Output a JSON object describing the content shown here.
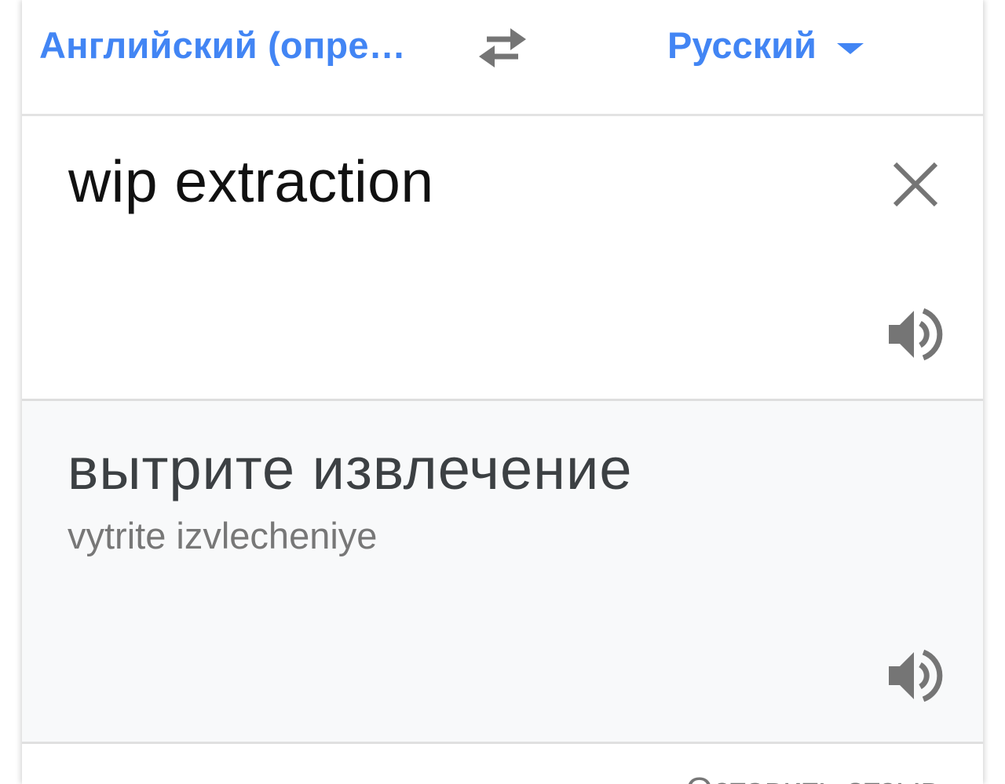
{
  "language_bar": {
    "source_language": "Английский (опре…",
    "target_language": "Русский",
    "swap_icon": "swap-arrows-icon",
    "dropdown_icon": "caret-down-icon"
  },
  "input": {
    "source_text": "wip extraction",
    "clear_icon": "close-icon",
    "speaker_icon": "speaker-icon"
  },
  "output": {
    "translation": "вытрите извлечение",
    "transliteration": "vytrite izvlecheniye",
    "speaker_icon": "speaker-icon"
  },
  "footer": {
    "feedback_label": "Оставить отзыв"
  },
  "colors": {
    "accent": "#4285f4",
    "icon": "#757575",
    "output_bg": "#f8f9fa"
  }
}
